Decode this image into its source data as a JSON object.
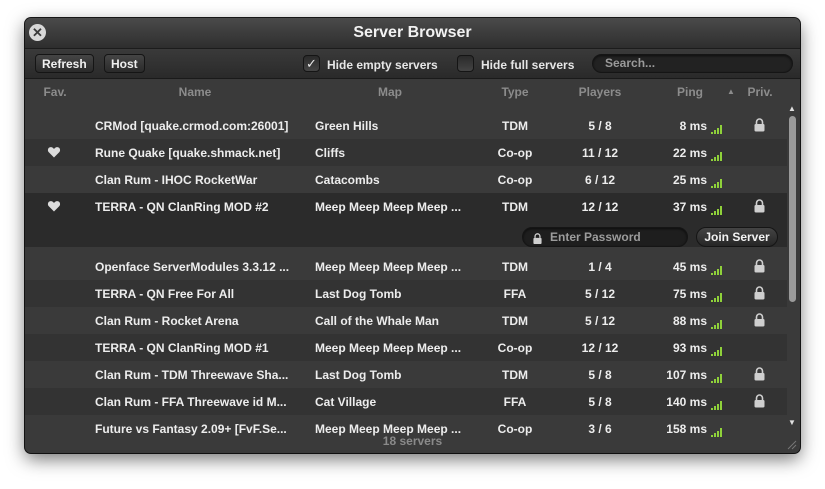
{
  "window": {
    "title": "Server Browser"
  },
  "toolbar": {
    "refresh_label": "Refresh",
    "host_label": "Host",
    "hide_empty_label": "Hide empty servers",
    "hide_empty_checked": true,
    "hide_full_label": "Hide full servers",
    "hide_full_checked": false,
    "search_placeholder": "Search..."
  },
  "columns": {
    "fav": "Fav.",
    "name": "Name",
    "map": "Map",
    "type": "Type",
    "players": "Players",
    "ping": "Ping",
    "priv": "Priv."
  },
  "sort": {
    "column": "Ping",
    "direction": "ascending"
  },
  "servers": [
    {
      "fav": false,
      "name": "CRMod [quake.crmod.com:26001]",
      "map": "Green Hills",
      "type": "TDM",
      "players": "5 / 8",
      "ping": "8 ms",
      "private": true
    },
    {
      "fav": true,
      "name": "Rune Quake [quake.shmack.net]",
      "map": "Cliffs",
      "type": "Co-op",
      "players": "11 / 12",
      "ping": "22 ms",
      "private": false
    },
    {
      "fav": false,
      "name": "Clan Rum - IHOC RocketWar",
      "map": "Catacombs",
      "type": "Co-op",
      "players": "6 / 12",
      "ping": "25 ms",
      "private": false
    },
    {
      "fav": true,
      "name": "TERRA - QN ClanRing MOD #2",
      "map": "Meep Meep Meep Meep ...",
      "type": "TDM",
      "players": "12 / 12",
      "ping": "37 ms",
      "private": true
    },
    {
      "fav": false,
      "name": "Openface ServerModules 3.3.12 ...",
      "map": "Meep Meep Meep Meep ...",
      "type": "TDM",
      "players": "1 / 4",
      "ping": "45 ms",
      "private": true
    },
    {
      "fav": false,
      "name": "TERRA - QN Free For All",
      "map": "Last Dog Tomb",
      "type": "FFA",
      "players": "5 / 12",
      "ping": "75 ms",
      "private": true
    },
    {
      "fav": false,
      "name": "Clan Rum - Rocket Arena",
      "map": "Call of the Whale Man",
      "type": "TDM",
      "players": "5 / 12",
      "ping": "88 ms",
      "private": true
    },
    {
      "fav": false,
      "name": "TERRA - QN ClanRing MOD #1",
      "map": "Meep Meep Meep Meep ...",
      "type": "Co-op",
      "players": "12 / 12",
      "ping": "93 ms",
      "private": false
    },
    {
      "fav": false,
      "name": "Clan Rum - TDM Threewave Sha...",
      "map": "Last Dog Tomb",
      "type": "TDM",
      "players": "5 / 8",
      "ping": "107 ms",
      "private": true
    },
    {
      "fav": false,
      "name": "Clan Rum - FFA Threewave id M...",
      "map": "Cat Village",
      "type": "FFA",
      "players": "5 / 8",
      "ping": "140 ms",
      "private": true
    },
    {
      "fav": false,
      "name": "Future vs Fantasy 2.09+ [FvF.Se...",
      "map": "Meep Meep Meep Meep ...",
      "type": "Co-op",
      "players": "3 / 6",
      "ping": "158 ms",
      "private": false
    }
  ],
  "selected": {
    "password_placeholder": "Enter Password",
    "join_label": "Join Server"
  },
  "footer": {
    "server_count": "18 servers"
  },
  "colors": {
    "signal_green": "#8fd13a",
    "signal_dim": "#4a5a3a"
  }
}
